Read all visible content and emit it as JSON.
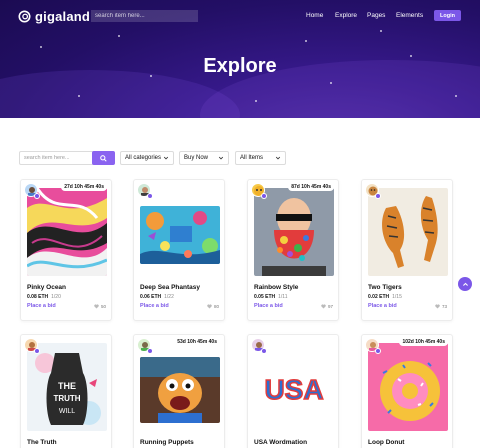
{
  "brand": {
    "name": "gigaland"
  },
  "header": {
    "search_placeholder": "search item here...",
    "nav": [
      "Home",
      "Explore",
      "Pages",
      "Elements"
    ],
    "login": "Login"
  },
  "hero": {
    "title": "Explore"
  },
  "filters": {
    "search_placeholder": "search item here...",
    "categories": "All categories",
    "buy": "Buy Now",
    "items": "All Items"
  },
  "colors": {
    "accent": "#7b57e8",
    "hero": "#2a1170"
  },
  "cards": [
    {
      "name": "Pinky Ocean",
      "price": "0.08 ETH",
      "stock": "1/20",
      "bid": "Place a bid",
      "likes": "50",
      "timer": "27d  10h  45m  40s"
    },
    {
      "name": "Deep Sea Phantasy",
      "price": "0.06 ETH",
      "stock": "1/22",
      "bid": "Place a bid",
      "likes": "80",
      "timer": ""
    },
    {
      "name": "Rainbow Style",
      "price": "0.05 ETH",
      "stock": "1/11",
      "bid": "Place a bid",
      "likes": "97",
      "timer": "87d  10h  45m  40s"
    },
    {
      "name": "Two Tigers",
      "price": "0.02 ETH",
      "stock": "1/15",
      "bid": "Place a bid",
      "likes": "73",
      "timer": ""
    },
    {
      "name": "The Truth",
      "price": "",
      "stock": "",
      "bid": "",
      "likes": "",
      "timer": ""
    },
    {
      "name": "Running Puppets",
      "price": "",
      "stock": "",
      "bid": "",
      "likes": "",
      "timer": "53d  10h  45m  40s"
    },
    {
      "name": "USA Wordmation",
      "price": "",
      "stock": "",
      "bid": "",
      "likes": "",
      "timer": ""
    },
    {
      "name": "Loop Donut",
      "price": "",
      "stock": "",
      "bid": "",
      "likes": "",
      "timer": "102d  10h  45m  40s"
    }
  ]
}
